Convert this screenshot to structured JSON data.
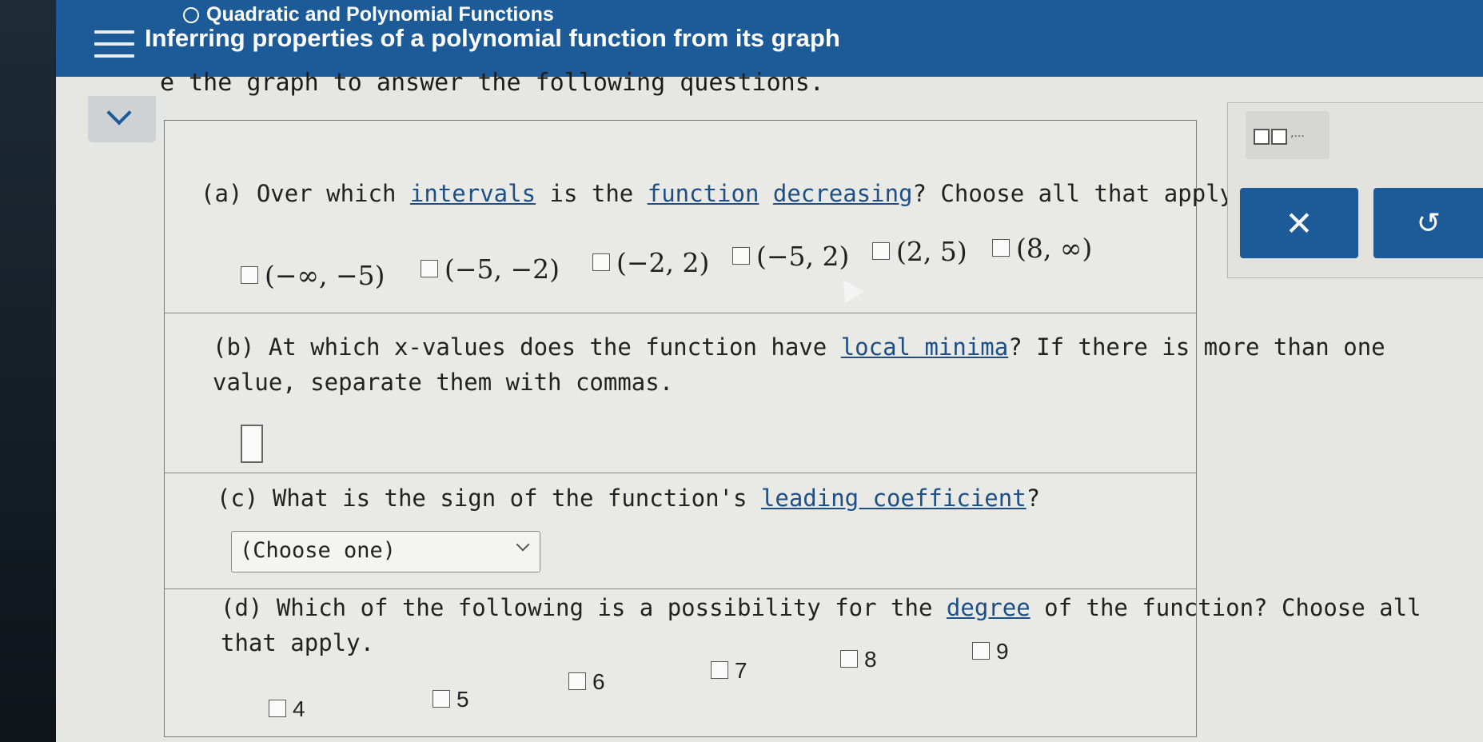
{
  "header": {
    "topic": "Quadratic and Polynomial Functions",
    "lesson": "Inferring properties of a polynomial function from its graph"
  },
  "intro_text": "e the graph to answer the following questions.",
  "question_a": {
    "prefix": "(a) Over which ",
    "link1": "intervals",
    "mid1": " is the ",
    "link2": "function",
    "space": " ",
    "link3": "decreasing",
    "suffix": "? Choose all that apply.",
    "options": [
      "(−∞, −5)",
      "(−5, −2)",
      "(−2, 2)",
      "(−5, 2)",
      "(2, 5)",
      "(8, ∞)"
    ]
  },
  "question_b": {
    "line1_prefix": "(b) At which x-values does the function have ",
    "link": "local minima",
    "line1_suffix": "? If there is more than one",
    "line2": "value, separate them with commas."
  },
  "question_c": {
    "prefix": "(c) What is the sign of the function's ",
    "link": "leading coefficient",
    "suffix": "?",
    "select_placeholder": "(Choose one)"
  },
  "question_d": {
    "line1_prefix": "(d) Which of the following is a possibility for the ",
    "link": "degree",
    "line1_suffix": " of the function? Choose all",
    "line2": "that apply.",
    "options": [
      "4",
      "5",
      "6",
      "7",
      "8",
      "9"
    ]
  },
  "tools": {
    "icon_text": ",..."
  },
  "colors": {
    "header_blue": "#1c5a98",
    "link_blue": "#1d4f86"
  },
  "icons": {
    "menu": "hamburger-menu-icon",
    "clear": "close-x-icon",
    "undo": "undo-arrow-icon",
    "collapse": "chevron-down-icon"
  }
}
